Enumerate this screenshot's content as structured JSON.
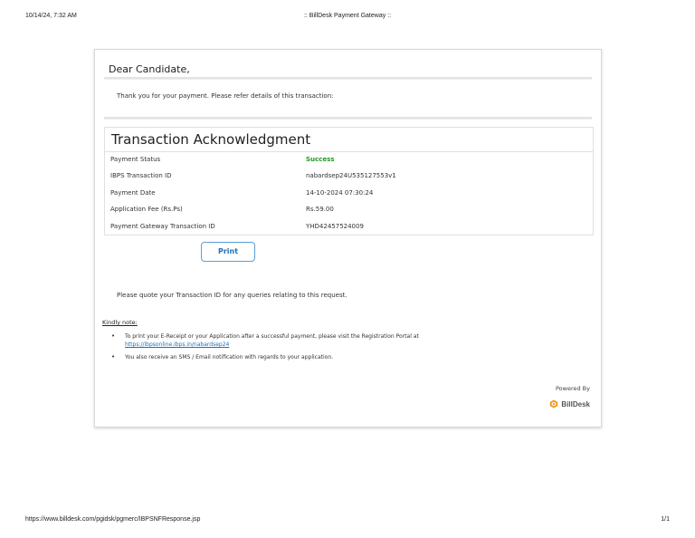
{
  "print_header": {
    "datetime": "10/14/24, 7:32 AM",
    "title": ":: BillDesk Payment Gateway ::"
  },
  "print_footer": {
    "url": "https://www.billdesk.com/pgidsk/pgmerc/IBPSNFResponse.jsp",
    "page": "1/1"
  },
  "receipt": {
    "greeting": "Dear Candidate,",
    "thanks": "Thank you for your payment. Please refer details of this transaction:",
    "section_title": "Transaction Acknowledgment",
    "rows": [
      {
        "label": "Payment Status",
        "value": "Success"
      },
      {
        "label": "IBPS Transaction ID",
        "value": "nabardsep24U535127553v1"
      },
      {
        "label": "Payment Date",
        "value": "14-10-2024 07:30:24"
      },
      {
        "label": "Application Fee (Rs.Ps)",
        "value": "Rs.59.00"
      },
      {
        "label": "Payment Gateway Transaction ID",
        "value": "YHD42457524009"
      }
    ],
    "status_color": "#1a9c1a",
    "print_label": "Print",
    "quote_note": "Please quote your Transaction ID for any queries relating to this request.",
    "kindly_note": "Kindly note:",
    "notes": [
      {
        "text": "To print your E-Receipt or your Application after a successful payment, please visit the Registration Portal at",
        "link": "https://ibpsonline.ibps.in/nabardsep24"
      },
      {
        "text": "You also receive an SMS / Email notification with regards to your application.",
        "link": ""
      }
    ],
    "powered_by": "Powered By",
    "brand": "BillDesk"
  }
}
